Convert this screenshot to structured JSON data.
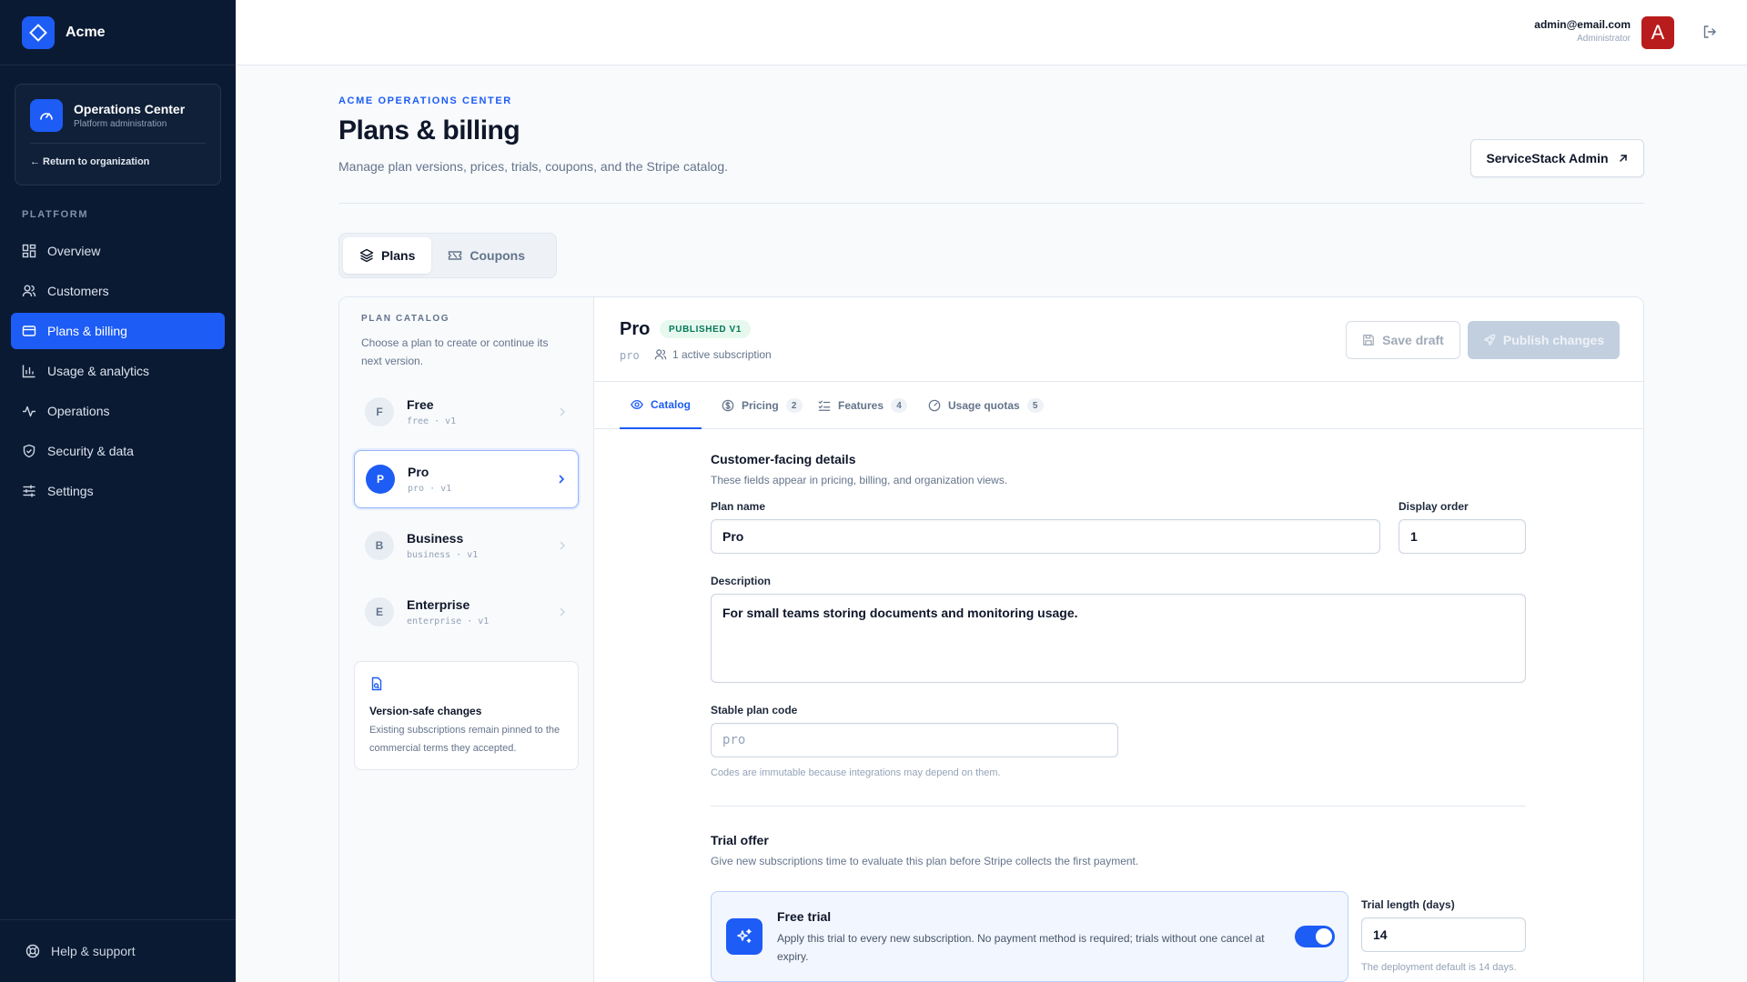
{
  "app": {
    "name": "Acme"
  },
  "ops_card": {
    "title": "Operations Center",
    "subtitle": "Platform administration",
    "return_label": "← Return to organization"
  },
  "sidebar": {
    "section_label": "PLATFORM",
    "items": [
      {
        "label": "Overview",
        "icon": "grid-icon"
      },
      {
        "label": "Customers",
        "icon": "users-icon"
      },
      {
        "label": "Plans & billing",
        "icon": "credit-card-icon",
        "active": true
      },
      {
        "label": "Usage & analytics",
        "icon": "bar-chart-icon"
      },
      {
        "label": "Operations",
        "icon": "activity-icon"
      },
      {
        "label": "Security & data",
        "icon": "shield-icon"
      },
      {
        "label": "Settings",
        "icon": "sliders-icon"
      }
    ],
    "help_label": "Help & support"
  },
  "user": {
    "email": "admin@email.com",
    "role": "Administrator",
    "avatar_letter": "A"
  },
  "header": {
    "eyebrow": "ACME OPERATIONS CENTER",
    "title": "Plans & billing",
    "subtitle": "Manage plan versions, prices, trials, coupons, and the Stripe catalog.",
    "admin_button": "ServiceStack Admin"
  },
  "top_tabs": [
    {
      "label": "Plans",
      "active": true
    },
    {
      "label": "Coupons"
    }
  ],
  "catalog": {
    "heading": "PLAN CATALOG",
    "subtitle": "Choose a plan to create or continue its next version.",
    "plans": [
      {
        "badge": "F",
        "name": "Free",
        "meta": "free · v1"
      },
      {
        "badge": "P",
        "name": "Pro",
        "meta": "pro · v1",
        "active": true
      },
      {
        "badge": "B",
        "name": "Business",
        "meta": "business · v1"
      },
      {
        "badge": "E",
        "name": "Enterprise",
        "meta": "enterprise · v1"
      }
    ],
    "version_card": {
      "title": "Version-safe changes",
      "text": "Existing subscriptions remain pinned to the commercial terms they accepted."
    }
  },
  "editor": {
    "plan_name": "Pro",
    "status_badge": "PUBLISHED V1",
    "plan_code": "pro",
    "subscriptions": "1 active subscription",
    "save_label": "Save draft",
    "publish_label": "Publish changes",
    "tabs": [
      {
        "label": "Catalog",
        "active": true
      },
      {
        "label": "Pricing",
        "count": "2"
      },
      {
        "label": "Features",
        "count": "4"
      },
      {
        "label": "Usage quotas",
        "count": "5"
      }
    ]
  },
  "form": {
    "details_title": "Customer-facing details",
    "details_sub": "These fields appear in pricing, billing, and organization views.",
    "plan_name_label": "Plan name",
    "plan_name_value": "Pro",
    "display_order_label": "Display order",
    "display_order_value": "1",
    "description_label": "Description",
    "description_value": "For small teams storing documents and monitoring usage.",
    "code_label": "Stable plan code",
    "code_value": "pro",
    "code_hint": "Codes are immutable because integrations may depend on them.",
    "trial_title": "Trial offer",
    "trial_sub": "Give new subscriptions time to evaluate this plan before Stripe collects the first payment.",
    "free_trial_title": "Free trial",
    "free_trial_text": "Apply this trial to every new subscription. No payment method is required; trials without one cancel at expiry.",
    "free_trial_enabled": true,
    "trial_length_label": "Trial length (days)",
    "trial_length_value": "14",
    "trial_length_hint": "The deployment default is 14 days."
  },
  "colors": {
    "accent": "#1d5cf5",
    "sidebar_bg": "#0b1a33",
    "published_green": "#047857",
    "avatar_red": "#b91c1c"
  }
}
